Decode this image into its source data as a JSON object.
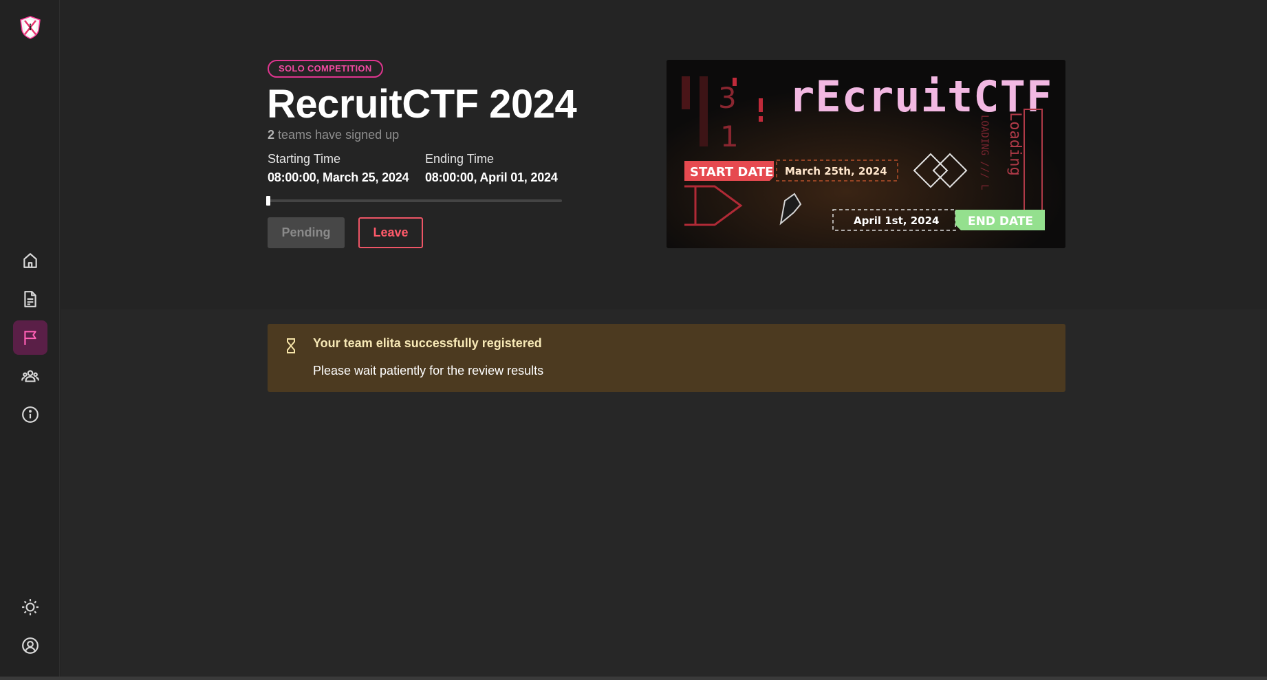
{
  "sidebar": {
    "logo": "ctf-shield-logo",
    "items": [
      {
        "icon": "home-icon"
      },
      {
        "icon": "document-icon"
      },
      {
        "icon": "flag-icon",
        "active": true
      },
      {
        "icon": "team-icon"
      },
      {
        "icon": "info-icon"
      }
    ],
    "bottom_items": [
      {
        "icon": "theme-brightness-icon"
      },
      {
        "icon": "user-account-icon"
      }
    ],
    "active_color": "#ff5fb4"
  },
  "competition": {
    "badge": "SOLO COMPETITION",
    "title": "RecruitCTF 2024",
    "signup_count": "2",
    "signup_text": " teams have signed up",
    "start_label": "Starting Time",
    "start_value": "08:00:00, March 25, 2024",
    "end_label": "Ending Time",
    "end_value": "08:00:00, April 01, 2024",
    "progress": 0.01,
    "pending_label": "Pending",
    "leave_label": "Leave"
  },
  "banner": {
    "logo_text": "rEcruitCTF",
    "start_tag": "START DATE",
    "start_date": "March 25th, 2024",
    "end_date": "April 1st, 2024",
    "end_tag": "END DATE",
    "loading_text": "Loading",
    "loading_small": "LOADING /// L",
    "numbers": [
      "3",
      "1"
    ]
  },
  "alert": {
    "title": "Your team elita successfully registered",
    "body": "Please wait patiently for the review results",
    "icon": "hourglass-icon",
    "background": "#4c3a20"
  }
}
